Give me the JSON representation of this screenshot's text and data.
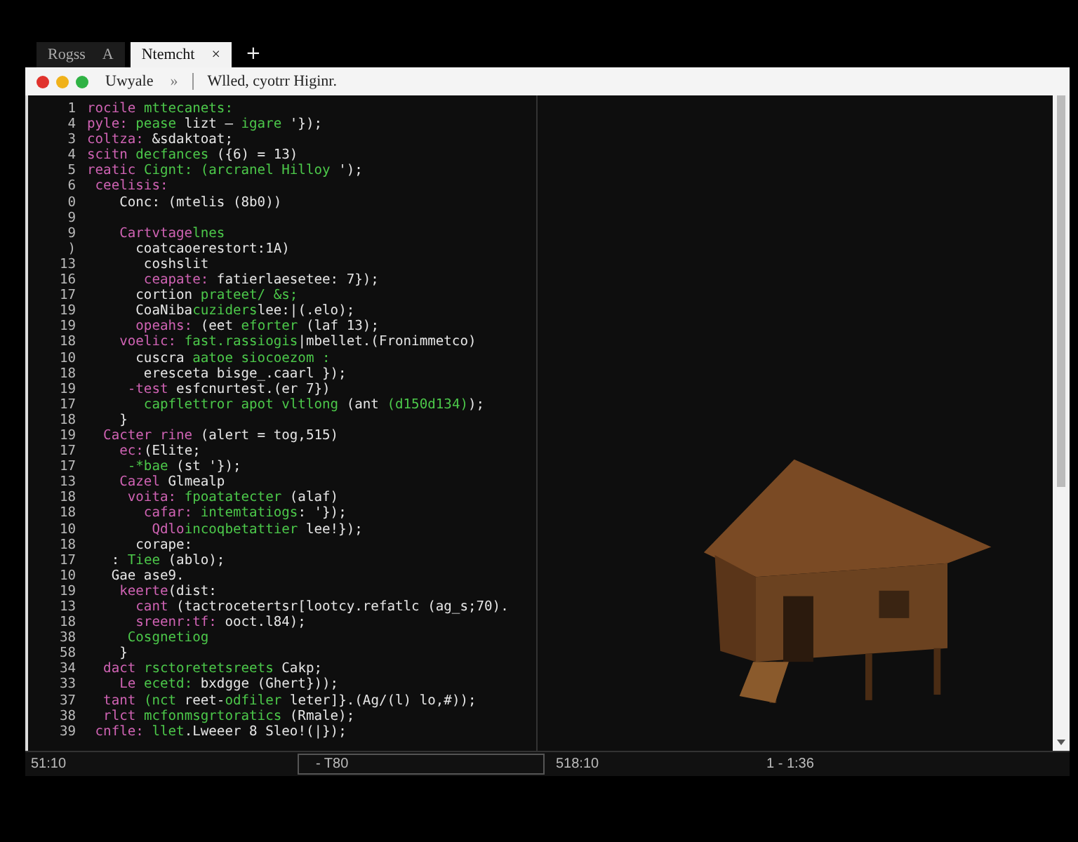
{
  "tabs": [
    {
      "label": "Rogss",
      "suffix": "A",
      "selected": false
    },
    {
      "label": "Ntemcht",
      "selected": true,
      "close": "×"
    }
  ],
  "new_tab": "+",
  "address_bar": {
    "site": "Uwyale",
    "chevron": "»",
    "title": "Wlled, cyotrr Higinr."
  },
  "code": [
    {
      "number": "1",
      "segments": [
        {
          "kind": "kw",
          "text": "rocile "
        },
        {
          "kind": "str",
          "text": "mttecanets:"
        }
      ]
    },
    {
      "number": "4",
      "segments": [
        {
          "kind": "kw",
          "text": "pyle: "
        },
        {
          "kind": "str",
          "text": "pease "
        },
        {
          "kind": "txt",
          "text": "lizt — "
        },
        {
          "kind": "str",
          "text": "igare "
        },
        {
          "kind": "txt",
          "text": "'});"
        }
      ]
    },
    {
      "number": "3",
      "segments": [
        {
          "kind": "kw",
          "text": "coltza: "
        },
        {
          "kind": "txt",
          "text": "&sdaktoat;"
        }
      ]
    },
    {
      "number": "4",
      "segments": [
        {
          "kind": "kw",
          "text": "scitn "
        },
        {
          "kind": "str",
          "text": "decfances "
        },
        {
          "kind": "txt",
          "text": "({6) = 13)"
        }
      ]
    },
    {
      "number": "5",
      "segments": [
        {
          "kind": "kw",
          "text": "reatic "
        },
        {
          "kind": "str",
          "text": "Cignt: (arcranel Hilloy "
        },
        {
          "kind": "txt",
          "text": "');"
        }
      ]
    },
    {
      "number": "6",
      "segments": [
        {
          "kind": "kw",
          "text": " ceelisis:"
        }
      ]
    },
    {
      "number": "0",
      "segments": [
        {
          "kind": "txt",
          "text": "    Conc: (mtelis (8b0))"
        }
      ]
    },
    {
      "number": "9"
    },
    {
      "number": "9",
      "segments": [
        {
          "kind": "kw",
          "text": "    Cartvtage"
        },
        {
          "kind": "str",
          "text": "lnes"
        }
      ]
    },
    {
      "number": ")",
      "segments": [
        {
          "kind": "txt",
          "text": "      coatcaoerestort:1A)"
        }
      ]
    },
    {
      "number": "13",
      "segments": [
        {
          "kind": "txt",
          "text": "       coshslit"
        }
      ]
    },
    {
      "number": "16",
      "segments": [
        {
          "kind": "kw",
          "text": "       ceapate: "
        },
        {
          "kind": "txt",
          "text": "fatierlaesetee: 7});"
        }
      ]
    },
    {
      "number": "17",
      "segments": [
        {
          "kind": "txt",
          "text": "      cortion "
        },
        {
          "kind": "str",
          "text": "prateet/ &s;"
        }
      ]
    },
    {
      "number": "19",
      "segments": [
        {
          "kind": "txt",
          "text": "      CoaNiba"
        },
        {
          "kind": "str",
          "text": "cuziders"
        },
        {
          "kind": "txt",
          "text": "lee:|(.elo);"
        }
      ]
    },
    {
      "number": "19",
      "segments": [
        {
          "kind": "kw",
          "text": "      opeahs: "
        },
        {
          "kind": "txt",
          "text": "(eet "
        },
        {
          "kind": "str",
          "text": "eforter "
        },
        {
          "kind": "txt",
          "text": "(laf 13);"
        }
      ]
    },
    {
      "number": "18",
      "segments": [
        {
          "kind": "kw",
          "text": "    voelic: "
        },
        {
          "kind": "str",
          "text": "fast.rassiogis"
        },
        {
          "kind": "txt",
          "text": "|mbellet.(Fronimmetco)"
        }
      ]
    },
    {
      "number": "10",
      "segments": [
        {
          "kind": "txt",
          "text": "      cuscra "
        },
        {
          "kind": "str",
          "text": "aatoe siocoezom :"
        }
      ]
    },
    {
      "number": "18",
      "segments": [
        {
          "kind": "txt",
          "text": "       eresceta bisge_.caarl });"
        }
      ]
    },
    {
      "number": "19",
      "segments": [
        {
          "kind": "kw",
          "text": "     -test "
        },
        {
          "kind": "txt",
          "text": "esfcnurtest.(er 7})"
        }
      ]
    },
    {
      "number": "17",
      "segments": [
        {
          "kind": "str",
          "text": "       capflettror apot vltlong "
        },
        {
          "kind": "txt",
          "text": "(ant "
        },
        {
          "kind": "str",
          "text": "(d150d134)"
        },
        {
          "kind": "txt",
          "text": ");"
        }
      ]
    },
    {
      "number": "18",
      "segments": [
        {
          "kind": "txt",
          "text": "    }"
        }
      ]
    },
    {
      "number": "19",
      "segments": [
        {
          "kind": "kw",
          "text": "  Cacter rine "
        },
        {
          "kind": "txt",
          "text": "(alert = tog,515)"
        }
      ]
    },
    {
      "number": "17",
      "segments": [
        {
          "kind": "kw",
          "text": "    ec:"
        },
        {
          "kind": "txt",
          "text": "(Elite;"
        }
      ]
    },
    {
      "number": "17",
      "segments": [
        {
          "kind": "str",
          "text": "     -*bae "
        },
        {
          "kind": "txt",
          "text": "(st '});"
        }
      ]
    },
    {
      "number": "13",
      "segments": [
        {
          "kind": "kw",
          "text": "    Cazel "
        },
        {
          "kind": "txt",
          "text": "Glmealp"
        }
      ]
    },
    {
      "number": "18",
      "segments": [
        {
          "kind": "kw",
          "text": "     voita: "
        },
        {
          "kind": "str",
          "text": "fpoatatecter "
        },
        {
          "kind": "txt",
          "text": "(alaf)"
        }
      ]
    },
    {
      "number": "18",
      "segments": [
        {
          "kind": "kw",
          "text": "       cafar: "
        },
        {
          "kind": "str",
          "text": "intemtatiogs"
        },
        {
          "kind": "txt",
          "text": ": '});"
        }
      ]
    },
    {
      "number": "10",
      "segments": [
        {
          "kind": "kw",
          "text": "        Qdlo"
        },
        {
          "kind": "str",
          "text": "incoqbetattier "
        },
        {
          "kind": "txt",
          "text": "lee!});"
        }
      ]
    },
    {
      "number": "18",
      "segments": [
        {
          "kind": "txt",
          "text": "      corape:"
        }
      ]
    },
    {
      "number": "17",
      "segments": [
        {
          "kind": "txt",
          "text": "   : "
        },
        {
          "kind": "str",
          "text": "Tiee "
        },
        {
          "kind": "txt",
          "text": "(ablo);"
        }
      ]
    },
    {
      "number": "10",
      "segments": [
        {
          "kind": "txt",
          "text": "   Gae ase9."
        }
      ]
    },
    {
      "number": "19",
      "segments": [
        {
          "kind": "kw",
          "text": "    keerte"
        },
        {
          "kind": "txt",
          "text": "(dist:"
        }
      ]
    },
    {
      "number": "13",
      "segments": [
        {
          "kind": "kw",
          "text": "      cant "
        },
        {
          "kind": "txt",
          "text": "(tactrocetertsr[lootcy.refatlc (ag_s;70)."
        }
      ]
    },
    {
      "number": "18",
      "segments": [
        {
          "kind": "kw",
          "text": "      sreenr:tf: "
        },
        {
          "kind": "txt",
          "text": "ooct.l84);"
        }
      ]
    },
    {
      "number": "38",
      "segments": [
        {
          "kind": "str",
          "text": "     Cosgnetiog"
        }
      ]
    },
    {
      "number": "58",
      "segments": [
        {
          "kind": "txt",
          "text": "    }"
        }
      ]
    },
    {
      "number": "34",
      "segments": [
        {
          "kind": "kw",
          "text": "  dact "
        },
        {
          "kind": "str",
          "text": "rsctoretetsreets "
        },
        {
          "kind": "txt",
          "text": "Cakp;"
        }
      ]
    },
    {
      "number": "33",
      "segments": [
        {
          "kind": "kw",
          "text": "    Le "
        },
        {
          "kind": "str",
          "text": "ecetd: "
        },
        {
          "kind": "txt",
          "text": "bxdgge (Ghert}));"
        }
      ]
    },
    {
      "number": "37",
      "segments": [
        {
          "kind": "kw",
          "text": "  tant "
        },
        {
          "kind": "str",
          "text": "(nct "
        },
        {
          "kind": "txt",
          "text": "reet-"
        },
        {
          "kind": "str",
          "text": "odfiler "
        },
        {
          "kind": "txt",
          "text": "leter]}.(Ag/(l) lo,#));"
        }
      ]
    },
    {
      "number": "38",
      "segments": [
        {
          "kind": "kw",
          "text": "  rlct "
        },
        {
          "kind": "str",
          "text": "mcfonmsgrtoratics "
        },
        {
          "kind": "txt",
          "text": "(Rmale);"
        }
      ]
    },
    {
      "number": "39",
      "segments": [
        {
          "kind": "kw",
          "text": " cnfle: "
        },
        {
          "kind": "str",
          "text": "llet"
        },
        {
          "kind": "txt",
          "text": ".Lweeer 8 Sleo!(|});"
        }
      ]
    }
  ],
  "status_bar": {
    "left_position": "51:10",
    "field_value": "- T80",
    "right_position": "518:10",
    "range": "1 - 1:36"
  }
}
